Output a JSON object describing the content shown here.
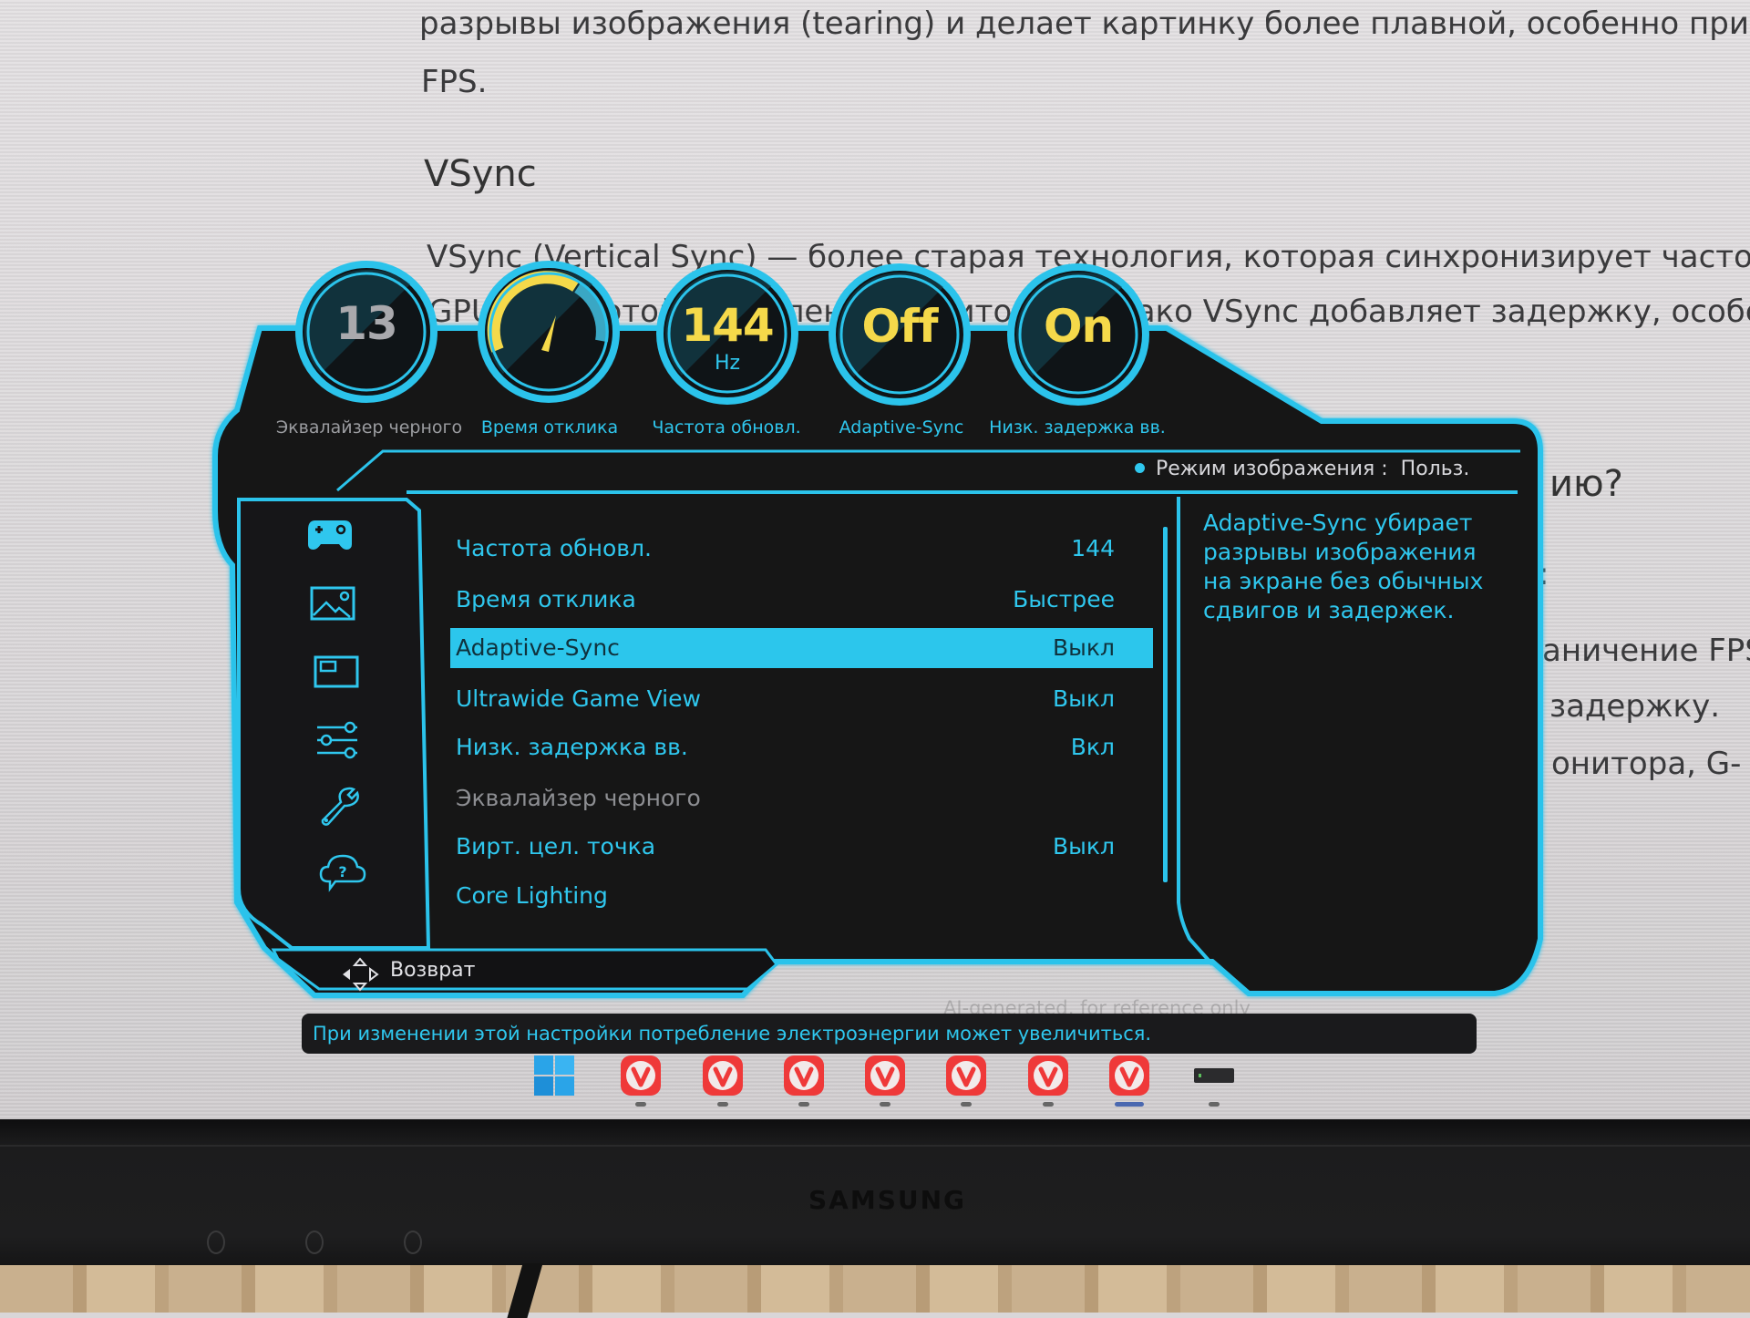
{
  "background_document": {
    "lines": [
      "разрывы изображения (tearing) и делает картинку более плавной, особенно при изм",
      "FPS.",
      "VSync (Vertical Sync) — более старая технология, которая синхронизирует частоту к",
      "GPU с частотой обновления монитора. Однако VSync добавляет задержку, особенно"
    ],
    "heading": "VSync",
    "section_heading_tail": "ию?",
    "line_fragment_1": ":",
    "line_fragment_2": "аничение FPS",
    "line_fragment_3": "задержку.",
    "line_fragment_4": "онитора, G-",
    "watermark": "AI-generated, for reference only"
  },
  "osd": {
    "gauges": [
      {
        "name": "black-equalizer",
        "value": "13",
        "unit": "",
        "label": "Эквалайзер черного",
        "active": false
      },
      {
        "name": "response-time",
        "value": "",
        "unit": "",
        "label": "Время отклика",
        "active": true,
        "level": 0.6
      },
      {
        "name": "refresh-rate",
        "value": "144",
        "unit": "Hz",
        "label": "Частота обновл.",
        "active": true
      },
      {
        "name": "adaptive-sync",
        "value": "Off",
        "unit": "",
        "label": "Adaptive-Sync",
        "active": true
      },
      {
        "name": "low-input-lag",
        "value": "On",
        "unit": "",
        "label": "Низк. задержка вв.",
        "active": true
      }
    ],
    "picture_mode": {
      "label": "Режим изображения :",
      "value": "Польз."
    },
    "sidebar": [
      {
        "icon": "gamepad-icon",
        "label": "Игра",
        "selected": true
      },
      {
        "icon": "picture-icon",
        "label": "Изображение",
        "selected": false
      },
      {
        "icon": "pip-icon",
        "label": "PIP/PBP",
        "selected": false
      },
      {
        "icon": "sliders-icon",
        "label": "Общие",
        "selected": false
      },
      {
        "icon": "wrench-icon",
        "label": "Система",
        "selected": false
      },
      {
        "icon": "support-icon",
        "label": "Поддержка",
        "selected": false
      }
    ],
    "menu_items": [
      {
        "label": "Частота обновл.",
        "value": "144",
        "state": "normal"
      },
      {
        "label": "Время отклика",
        "value": "Быстрее",
        "state": "normal"
      },
      {
        "label": "Adaptive-Sync",
        "value": "Выкл",
        "state": "selected"
      },
      {
        "label": "Ultrawide Game View",
        "value": "Выкл",
        "state": "normal"
      },
      {
        "label": "Низк. задержка вв.",
        "value": "Вкл",
        "state": "normal"
      },
      {
        "label": "Эквалайзер черного",
        "value": "",
        "state": "disabled"
      },
      {
        "label": "Вирт. цел. точка",
        "value": "Выкл",
        "state": "normal"
      },
      {
        "label": "Core Lighting",
        "value": "",
        "state": "normal"
      }
    ],
    "description": "Adaptive-Sync убирает разрывы изображения на экране без обычных сдвигов и задержек.",
    "back_label": "Возврат",
    "tooltip": "При изменении этой настройки потребление электроэнергии может увеличиться."
  },
  "taskbar": {
    "items": [
      {
        "icon": "windows-start-icon",
        "active": false
      },
      {
        "icon": "vivaldi-icon",
        "active": false
      },
      {
        "icon": "vivaldi-icon",
        "active": false
      },
      {
        "icon": "vivaldi-icon",
        "active": false
      },
      {
        "icon": "vivaldi-icon",
        "active": false
      },
      {
        "icon": "vivaldi-icon",
        "active": false
      },
      {
        "icon": "vivaldi-icon",
        "active": false
      },
      {
        "icon": "vivaldi-icon",
        "active": true
      },
      {
        "icon": "terminal-icon",
        "active": false
      }
    ]
  },
  "monitor": {
    "brand": "SAMSUNG"
  },
  "colors": {
    "accent": "#2fc7ee",
    "gauge_value": "#f5d94a",
    "panel": "#141416",
    "vivaldi": "#ef3939"
  }
}
